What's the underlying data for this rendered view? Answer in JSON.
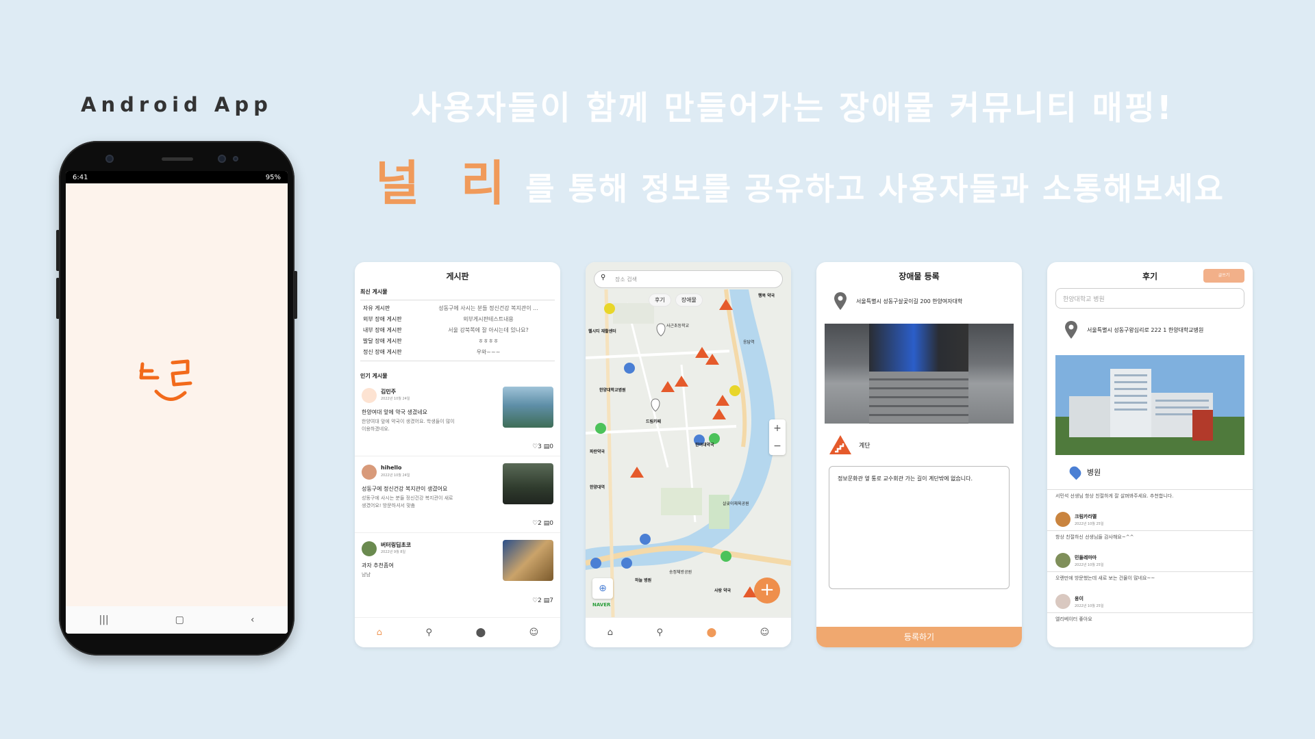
{
  "header": {
    "platform_label": "Android App",
    "headline": "사용자들이 함께 만들어가는 장애물 커뮤니티 매핑!",
    "brand": "널 리",
    "tagline": "를 통해 정보를 공유하고 사용자들과 소통해보세요"
  },
  "phone": {
    "time": "6:41",
    "status_right": "95%",
    "logo_text": "널리"
  },
  "board": {
    "title": "게시판",
    "recent_section": "최신 게시물",
    "boards": [
      {
        "name": "자유 게시판",
        "preview": "성동구에 사시는 분들 정신건강 복지관이 ..."
      },
      {
        "name": "외부 장애 게시판",
        "preview": "외부게시판테스트내용"
      },
      {
        "name": "내부 장애 게시판",
        "preview": "서울 강북쪽에 잘 아시는데 있나요?"
      },
      {
        "name": "발달 장애 게시판",
        "preview": "ㅎㅎㅎㅎ"
      },
      {
        "name": "정신 장애 게시판",
        "preview": "우와~~~"
      }
    ],
    "popular_section": "인기 게시물",
    "posts": [
      {
        "author": "김민주",
        "date": "2022년 10월 24일",
        "title": "한양여대 앞에 약국 생겼네요",
        "body": "한양여대 앞에 약국이 생겼어요. 학생들이 많이 이용하겠네요.",
        "likes": "3",
        "comments": "0"
      },
      {
        "author": "hihello",
        "date": "2022년 10월 24일",
        "title": "성동구에 정신건강 복지관이 생겼어요",
        "body": "성동구에 사시는 분들 정신건강 복지관이 새로 생겼어요! 방문하셔서 맞춤",
        "likes": "2",
        "comments": "0"
      },
      {
        "author": "버터링딥초코",
        "date": "2022년 9월 8일",
        "title": "과자 추천좀여",
        "body": "냠냠",
        "likes": "2",
        "comments": "7"
      }
    ]
  },
  "map": {
    "search_placeholder": "장소 검색",
    "chip_review": "후기",
    "chip_obstacle": "장애물",
    "places": [
      {
        "name": "행복 약국"
      },
      {
        "name": "사근초등학교"
      },
      {
        "name": "헬시티 재활센터"
      },
      {
        "name": "한양대학교병원"
      },
      {
        "name": "드림카페"
      },
      {
        "name": "한여대약국"
      },
      {
        "name": "파란약국"
      },
      {
        "name": "한양대역"
      },
      {
        "name": "하늘 병원"
      },
      {
        "name": "송정체방공원"
      },
      {
        "name": "사랑 약국"
      },
      {
        "name": "살곶이체육공원"
      },
      {
        "name": "응답역"
      }
    ],
    "naver": "NAVER"
  },
  "register": {
    "title": "장애물 등록",
    "address": "서울특별시 성동구살곶이길 200 한양여자대학",
    "type": "계단",
    "memo": "정보문화관 옆 통로 교수회관 가는 길이 계단밖에 없습니다.",
    "submit": "등록하기"
  },
  "review": {
    "title": "후기",
    "write_button": "글쓰기",
    "search_value": "한양대학교 병원",
    "address": "서울특별시 성동구왕십리로 222 1 한양대학교병원",
    "category": "병원",
    "reviews": [
      {
        "text": "서민석 선생님 항상 친절하게 잘 살펴봐주세요. 추천합니다.",
        "name": "크림카라멜",
        "date": "2022년 10월 25일"
      },
      {
        "text": "항상 친절하신 선생님들 감사해요~^^",
        "name": "민들레마마",
        "date": "2022년 10월 25일"
      },
      {
        "text": "오랜만에 방문했는데 새로 보는 건물이 많네요~~",
        "name": "옹이",
        "date": "2022년 10월 25일"
      }
    ],
    "more": "엘리베이터 좋아요"
  },
  "colors": {
    "accent": "#f09a5a",
    "background": "#deebf4"
  }
}
